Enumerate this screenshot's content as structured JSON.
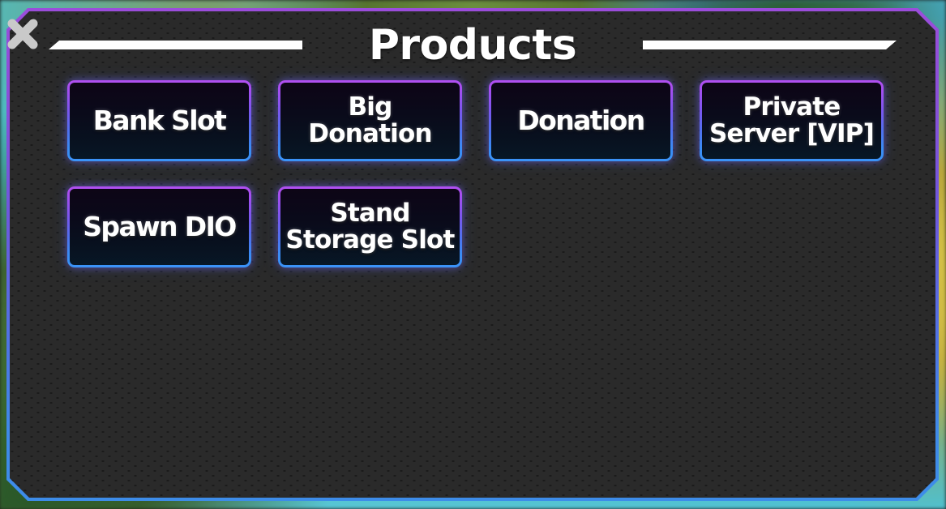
{
  "window": {
    "title": "Products",
    "close_icon": "close-x-icon",
    "accent_top": "#9b4ddb",
    "accent_bottom": "#3d8ce9",
    "panel_background": "#2a2a2a",
    "close_icon_color": "#c8c8c8",
    "divider_color": "#ffffff"
  },
  "products": [
    {
      "label": "Bank Slot",
      "lines": 1,
      "style": "wide"
    },
    {
      "label": "Big\nDonation",
      "lines": 2,
      "style": "two-line"
    },
    {
      "label": "Donation",
      "lines": 1,
      "style": "wide"
    },
    {
      "label": "Private\nServer [VIP]",
      "lines": 2,
      "style": "two-line"
    },
    {
      "label": "Spawn DIO",
      "lines": 1,
      "style": "wide"
    },
    {
      "label": "Stand\nStorage Slot",
      "lines": 2,
      "style": "two-line"
    }
  ]
}
